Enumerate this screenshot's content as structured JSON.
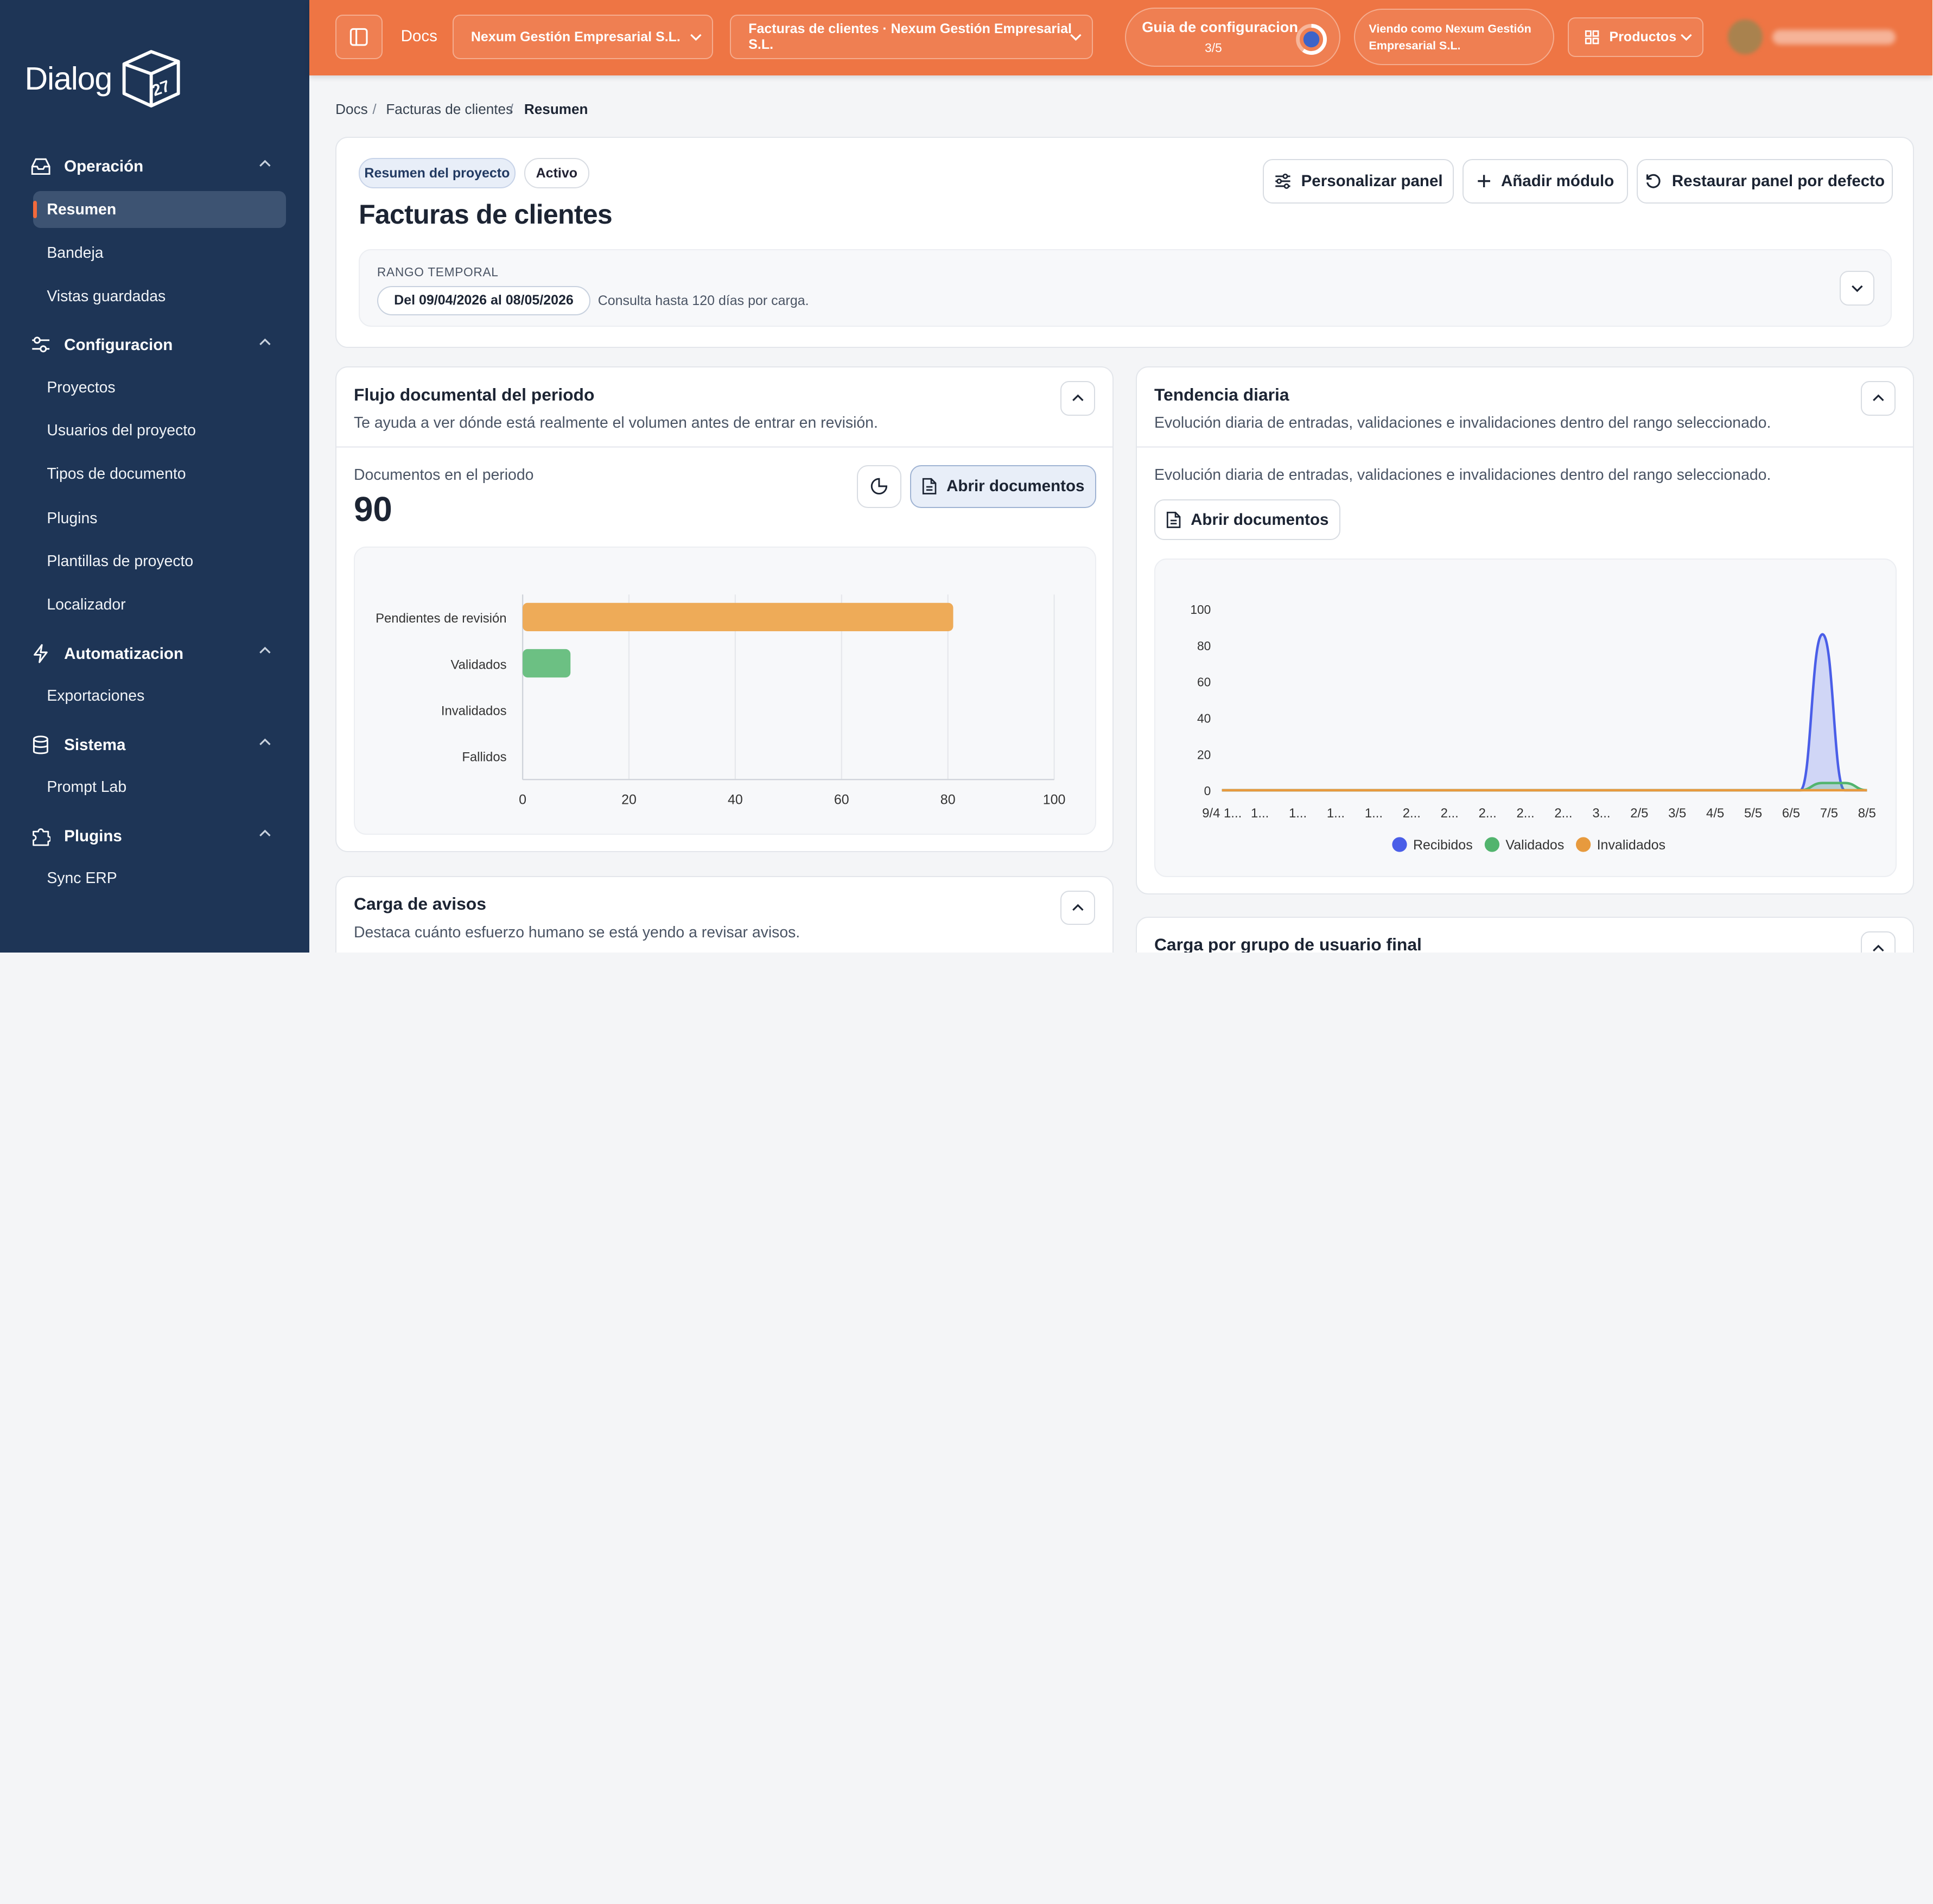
{
  "brand": {
    "name": "Dialog",
    "badge": "27"
  },
  "sidebar": {
    "sections": [
      {
        "label": "Operación",
        "icon": "inbox-icon"
      },
      {
        "label": "Configuracion",
        "icon": "sliders-icon"
      },
      {
        "label": "Automatizacion",
        "icon": "bolt-icon"
      },
      {
        "label": "Sistema",
        "icon": "database-icon"
      },
      {
        "label": "Plugins",
        "icon": "puzzle-icon"
      }
    ],
    "items": [
      "Resumen",
      "Bandeja",
      "Vistas guardadas",
      "Proyectos",
      "Usuarios del proyecto",
      "Tipos de documento",
      "Plugins",
      "Plantillas de proyecto",
      "Localizador",
      "Exportaciones",
      "Prompt Lab",
      "Sync ERP"
    ],
    "active_item": "Resumen"
  },
  "header": {
    "app_label": "Docs",
    "company_select": "Nexum Gestión Empresarial S.L.",
    "project_select": "Facturas de clientes · Nexum Gestión Empresarial S.L.",
    "guide_title": "Guia de configuracion",
    "guide_progress": "3/5",
    "guide_fraction": 0.6,
    "viewing_as": "Viendo como Nexum Gestión Empresarial S.L.",
    "products_label": "Productos"
  },
  "breadcrumb": [
    "Docs",
    "Facturas de clientes",
    "Resumen"
  ],
  "overview": {
    "badge_summary": "Resumen del proyecto",
    "badge_status": "Activo",
    "title": "Facturas de clientes",
    "btn_customize": "Personalizar panel",
    "btn_add": "Añadir módulo",
    "btn_restore": "Restaurar panel por defecto",
    "range_label": "RANGO TEMPORAL",
    "range_value": "Del 09/04/2026 al 08/05/2026",
    "range_note": "Consulta hasta 120 días por carga."
  },
  "flow_card": {
    "title": "Flujo documental del periodo",
    "subtitle": "Te ayuda a ver dónde está realmente el volumen antes de entrar en revisión.",
    "count_label": "Documentos en el periodo",
    "count_value": "90",
    "open_label": "Abrir documentos"
  },
  "trend_card": {
    "title": "Tendencia diaria",
    "subtitle": "Evolución diaria de entradas, validaciones e invalidaciones dentro del rango seleccionado.",
    "body_text": "Evolución diaria de entradas, validaciones e invalidaciones dentro del rango seleccionado.",
    "open_label": "Abrir documentos"
  },
  "alerts_card": {
    "title": "Carga de avisos",
    "subtitle": "Destaca cuánto esfuerzo humano se está yendo a revisar avisos."
  },
  "group_card": {
    "title": "Carga por grupo de usuario final"
  },
  "colors": {
    "sidebar": "#1e3556",
    "header": "#ee7544",
    "accent": "#f26a3c"
  },
  "chart_data": [
    {
      "type": "bar",
      "orientation": "horizontal",
      "categories": [
        "Pendientes de revisión",
        "Validados",
        "Invalidados",
        "Fallidos"
      ],
      "values": [
        81,
        9,
        0,
        0
      ],
      "colors": [
        "#eeab58",
        "#6cc083",
        "#e05555",
        "#999999"
      ],
      "xlim": [
        0,
        100
      ],
      "xticks": [
        "0",
        "20",
        "40",
        "60",
        "80",
        "100"
      ],
      "grid": true
    },
    {
      "type": "area",
      "x_tick_labels": [
        "9/4 1...",
        "1...",
        "1...",
        "1...",
        "1...",
        "2...",
        "2...",
        "2...",
        "2...",
        "2...",
        "3...",
        "2/5",
        "3/5",
        "4/5",
        "5/5",
        "6/5",
        "7/5",
        "8/5"
      ],
      "ylim": [
        0,
        100
      ],
      "yticks": [
        "0",
        "20",
        "40",
        "60",
        "80",
        "100"
      ],
      "series": [
        {
          "name": "Recibidos",
          "color": "#4a5ee8",
          "values": [
            0,
            0,
            0,
            0,
            0,
            0,
            0,
            0,
            0,
            0,
            0,
            0,
            0,
            0,
            0,
            0,
            0,
            0,
            0,
            0,
            0,
            0,
            0,
            0,
            0,
            0,
            0,
            86,
            0,
            0
          ]
        },
        {
          "name": "Validados",
          "color": "#52b46e",
          "values": [
            0,
            0,
            0,
            0,
            0,
            0,
            0,
            0,
            0,
            0,
            0,
            0,
            0,
            0,
            0,
            0,
            0,
            0,
            0,
            0,
            0,
            0,
            0,
            0,
            0,
            0,
            0,
            4,
            4,
            0
          ]
        },
        {
          "name": "Invalidados",
          "color": "#e79a3e",
          "values": [
            0,
            0,
            0,
            0,
            0,
            0,
            0,
            0,
            0,
            0,
            0,
            0,
            0,
            0,
            0,
            0,
            0,
            0,
            0,
            0,
            0,
            0,
            0,
            0,
            0,
            0,
            0,
            0,
            0,
            0
          ]
        }
      ],
      "legend": "bottom",
      "grid": false
    }
  ]
}
